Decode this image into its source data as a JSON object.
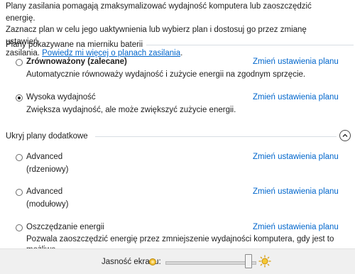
{
  "intro": {
    "line1": "Plany zasilania pomagają zmaksymalizować wydajność komputera lub zaoszczędzić energię.",
    "line2": "Zaznacz plan w celu jego uaktywnienia lub wybierz plan i dostosuj go przez zmianę ustawień",
    "line3_prefix": "zasilania. ",
    "link": "Powiedz mi więcej o planach zasilania",
    "line3_suffix": "."
  },
  "battery_plans": {
    "header": "Plany pokazywane na mierniku baterii",
    "plans": [
      {
        "name": "Zrównoważony (zalecane)",
        "description": "Automatycznie równoważy wydajność i zużycie energii na zgodnym sprzęcie.",
        "selected": false,
        "change_link": "Zmień ustawienia planu"
      },
      {
        "name": "Wysoka wydajność",
        "description": "Zwiększa wydajność, ale może zwiększyć zużycie energii.",
        "selected": true,
        "change_link": "Zmień ustawienia planu"
      }
    ]
  },
  "additional_plans": {
    "header": "Ukryj plany dodatkowe",
    "collapse_icon": "chevron-up-icon",
    "plans": [
      {
        "name": "Advanced",
        "description": "(rdzeniowy)",
        "selected": false,
        "change_link": "Zmień ustawienia planu"
      },
      {
        "name": "Advanced",
        "description": "(modułowy)",
        "selected": false,
        "change_link": "Zmień ustawienia planu"
      },
      {
        "name": "Oszczędzanie energii",
        "description": "Pozwala zaoszczędzić energię przez zmniejszenie wydajności komputera, gdy jest to",
        "description_cut": "możliwe.",
        "selected": false,
        "change_link": "Zmień ustawienia planu"
      }
    ]
  },
  "brightness": {
    "label": "Jasność ekranu:",
    "level_percent": 100,
    "icon_low": "sun-dim-icon",
    "icon_high": "sun-bright-icon"
  },
  "colors": {
    "link": "#0066cc",
    "bottom_bar": "#f0f0f0",
    "group_line": "#d8dde3"
  }
}
